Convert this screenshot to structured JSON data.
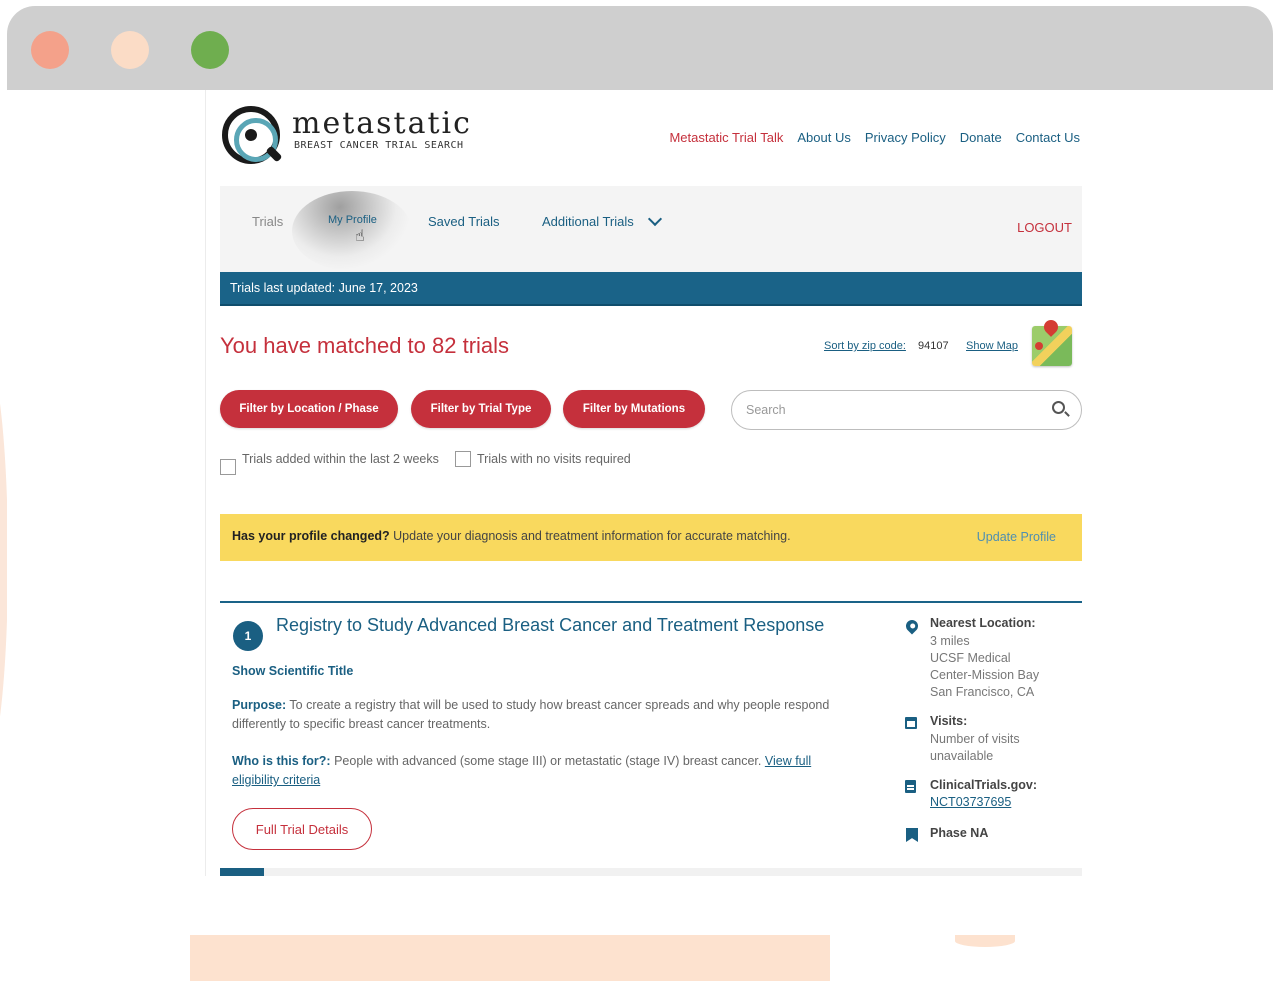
{
  "window": {
    "controls": [
      "close",
      "minimize",
      "maximize"
    ],
    "colors": {
      "close": "#f4a18a",
      "minimize": "#fbdcc6",
      "maximize": "#6fae4f"
    }
  },
  "brand": {
    "name": "metastatic",
    "tagline": "BREAST CANCER TRIAL SEARCH",
    "logo_icon": "magnifier-target-icon"
  },
  "top_nav": {
    "items": [
      "Metastatic Trial Talk",
      "About Us",
      "Privacy Policy",
      "Donate",
      "Contact Us"
    ]
  },
  "main_nav": {
    "trials": "Trials",
    "my_profile": "My Profile",
    "saved_trials": "Saved Trials",
    "additional_trials": "Additional Trials",
    "logout": "LOGOUT"
  },
  "update_bar": {
    "text": "Trials last updated: June 17, 2023"
  },
  "results": {
    "matched": "You have matched to 82 trials",
    "sort_label": "Sort by zip code:",
    "zip": "94107",
    "show_map": "Show Map"
  },
  "filters": {
    "location_phase": "Filter by Location / Phase",
    "trial_type": "Filter by Trial Type",
    "mutations": "Filter by Mutations"
  },
  "search": {
    "placeholder": "Search",
    "value": ""
  },
  "checkboxes": {
    "recent": "Trials added within the last 2 weeks",
    "no_visits": "Trials with no visits required"
  },
  "banner": {
    "bold": "Has your profile changed?",
    "text": " Update your diagnosis and treatment information for accurate matching.",
    "link": "Update Profile"
  },
  "trial": {
    "number": "1",
    "title": "Registry to Study Advanced Breast Cancer and Treatment Response",
    "show_scientific": "Show Scientific Title",
    "purpose_label": "Purpose:",
    "purpose": " To create a registry that will be used to study how breast cancer spreads and why people respond differently to specific breast cancer treatments.",
    "who_label": "Who is this for?:",
    "who": " People with advanced (some stage III) or metastatic (stage IV) breast cancer. ",
    "eligibility_link": "View full eligibility criteria",
    "details_button": "Full Trial Details",
    "nearest_label": "Nearest Location:",
    "nearest_lines": [
      "3 miles",
      "UCSF Medical",
      "Center-Mission Bay",
      "San Francisco, CA"
    ],
    "visits_label": "Visits:",
    "visits_lines": [
      "Number of visits",
      "unavailable"
    ],
    "ct_label": "ClinicalTrials.gov:",
    "ct_id": "NCT03737695",
    "phase": "Phase NA"
  },
  "colors": {
    "brand_red": "#c5303c",
    "brand_blue": "#1a5f82",
    "banner_yellow": "#f9d95e"
  }
}
